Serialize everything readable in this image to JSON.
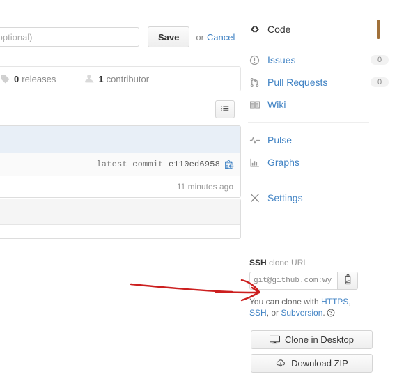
{
  "repo_edit": {
    "description_placeholder": "for this repository (optional)",
    "description_value": "",
    "save_label": "Save",
    "or_label": "or",
    "cancel_label": "Cancel"
  },
  "summary": {
    "releases_count": "0",
    "releases_label": "releases",
    "contributors_count": "1",
    "contributors_label": "contributor"
  },
  "file_panel": {
    "latest_commit_label": "latest commit",
    "commit_sha": "e110ed6958",
    "time_ago": "11 minutes ago"
  },
  "sidebar": {
    "nav": [
      {
        "label": "Code",
        "count": "",
        "icon": "code-icon",
        "active": true
      },
      {
        "label": "Issues",
        "count": "0",
        "icon": "issue-opened-icon",
        "active": false
      },
      {
        "label": "Pull Requests",
        "count": "0",
        "icon": "git-pull-request-icon",
        "active": false
      },
      {
        "label": "Wiki",
        "count": "",
        "icon": "book-icon",
        "active": false
      },
      {
        "label": "Pulse",
        "count": "",
        "icon": "pulse-icon",
        "active": false
      },
      {
        "label": "Graphs",
        "count": "",
        "icon": "graph-icon",
        "active": false
      },
      {
        "label": "Settings",
        "count": "",
        "icon": "tools-icon",
        "active": false
      }
    ],
    "clone": {
      "protocol_label": "SSH",
      "clone_url_label": "clone URL",
      "url_value": "git@github.com:wyl",
      "help_prefix": "You can clone with ",
      "help_https": "HTTPS",
      "help_comma": ", ",
      "help_ssh": "SSH",
      "help_mid": ", or ",
      "help_svn": "Subversion",
      "help_suffix": "."
    },
    "buttons": {
      "clone_desktop": "Clone in Desktop",
      "download_zip": "Download ZIP"
    }
  },
  "colors": {
    "accent_active": "#a1713a",
    "link": "#4183c4",
    "panel_head_blue": "#e8eff7",
    "annotation_red": "#cc1f1f"
  }
}
